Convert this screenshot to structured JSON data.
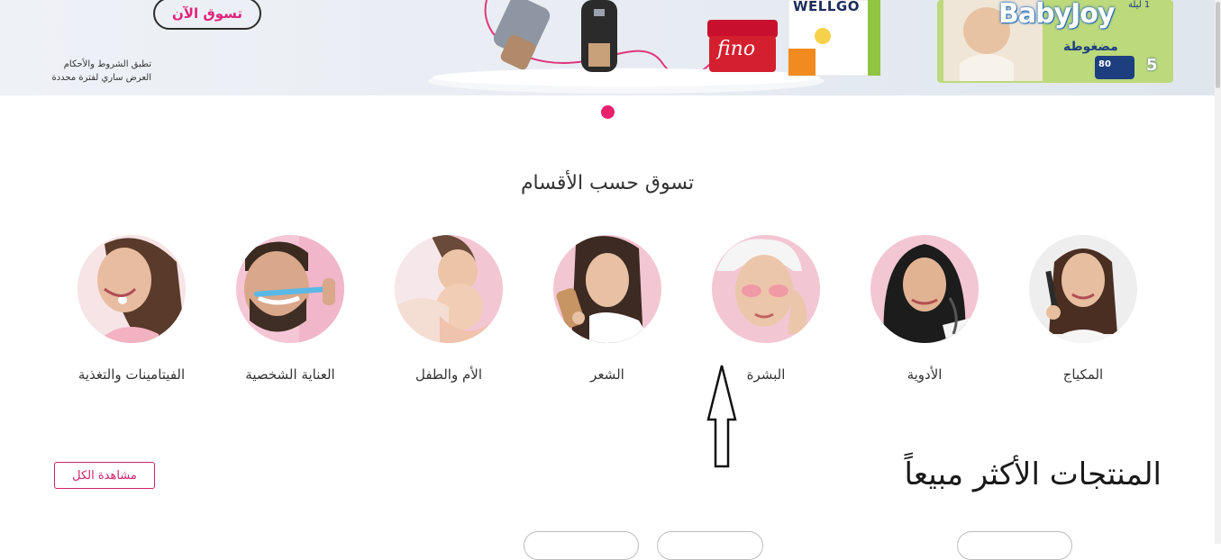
{
  "banner": {
    "shop_now_label": "تسوق الآن",
    "terms_line1": "تطبق الشروط والأحكام",
    "terms_line2": "العرض ساري لفترة محددة",
    "brand_wellgo": "WELLGO",
    "brand_fino": "fino",
    "brand_babyjoy": "BabyJoy",
    "babyjoy_subtitle": "مضغوطة",
    "babyjoy_count": "80",
    "babyjoy_size": "5",
    "babyjoy_tag": "1 ليلة"
  },
  "carousel": {
    "active_dot_color": "#e8216f"
  },
  "categories": {
    "title": "تسوق حسب الأقسام",
    "items": [
      {
        "label": "الفيتامينات والتغذية",
        "icon": "vitamins-woman-photo"
      },
      {
        "label": "العناية الشخصية",
        "icon": "personal-care-man-photo"
      },
      {
        "label": "الأم والطفل",
        "icon": "mother-baby-photo"
      },
      {
        "label": "الشعر",
        "icon": "hair-woman-photo"
      },
      {
        "label": "البشرة",
        "icon": "skin-woman-photo"
      },
      {
        "label": "الأدوية",
        "icon": "medicine-woman-photo"
      },
      {
        "label": "المكياج",
        "icon": "makeup-woman-photo"
      }
    ]
  },
  "best_sellers": {
    "title": "المنتجات الأكثر مبيعاً",
    "view_all_label": "مشاهدة الكل"
  },
  "colors": {
    "accent": "#e8216f",
    "pink_bg": "#f3c3d3"
  }
}
